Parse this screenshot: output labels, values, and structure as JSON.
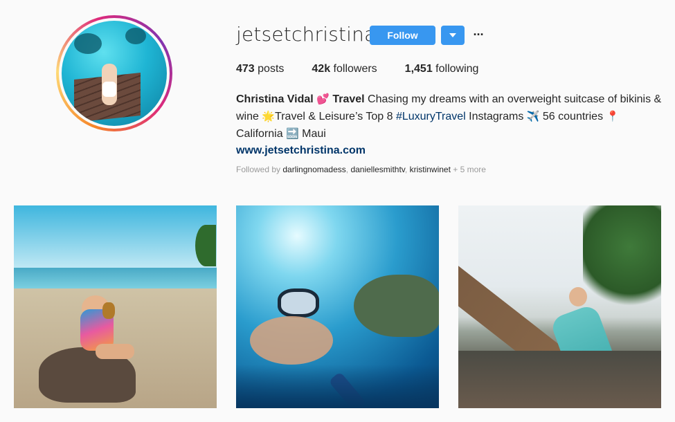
{
  "profile": {
    "username": "jetsetchristina",
    "follow_label": "Follow",
    "more_label": "···",
    "stats": [
      {
        "count": "473",
        "label": " posts"
      },
      {
        "count": "42k",
        "label": " followers"
      },
      {
        "count": "1,451",
        "label": " following"
      }
    ],
    "bio": {
      "name": "Christina Vidal",
      "emoji_heart": "💕",
      "title": "Travel",
      "text1": " Chasing my dreams with an overweight suitcase of bikinis & wine ",
      "emoji_star": "🌟",
      "text2": "Travel & Leisure’s Top 8 ",
      "hashtag": "#LuxuryTravel",
      "text3": " Instagrams ",
      "emoji_plane": "✈️",
      "text4": " 56 countries ",
      "emoji_pin": "📍",
      "text5": "California ",
      "emoji_soon": "🔜",
      "text6": " Maui",
      "website": "www.jetsetchristina.com"
    },
    "followed_by": {
      "prefix": "Followed by ",
      "users": [
        "darlingnomadess",
        "daniellesmithtv",
        "kristinwinet"
      ],
      "more": " + 5 more"
    }
  },
  "posts": [
    {
      "subject": "woman sitting on beach rock holding pineapple"
    },
    {
      "subject": "underwater snorkel selfie with sea turtle"
    },
    {
      "subject": "woman in dress on leaning palm tree"
    }
  ],
  "colors": {
    "accent": "#3897f0",
    "link": "#003569",
    "background": "#fafafa",
    "text": "#262626",
    "muted": "#999999"
  }
}
